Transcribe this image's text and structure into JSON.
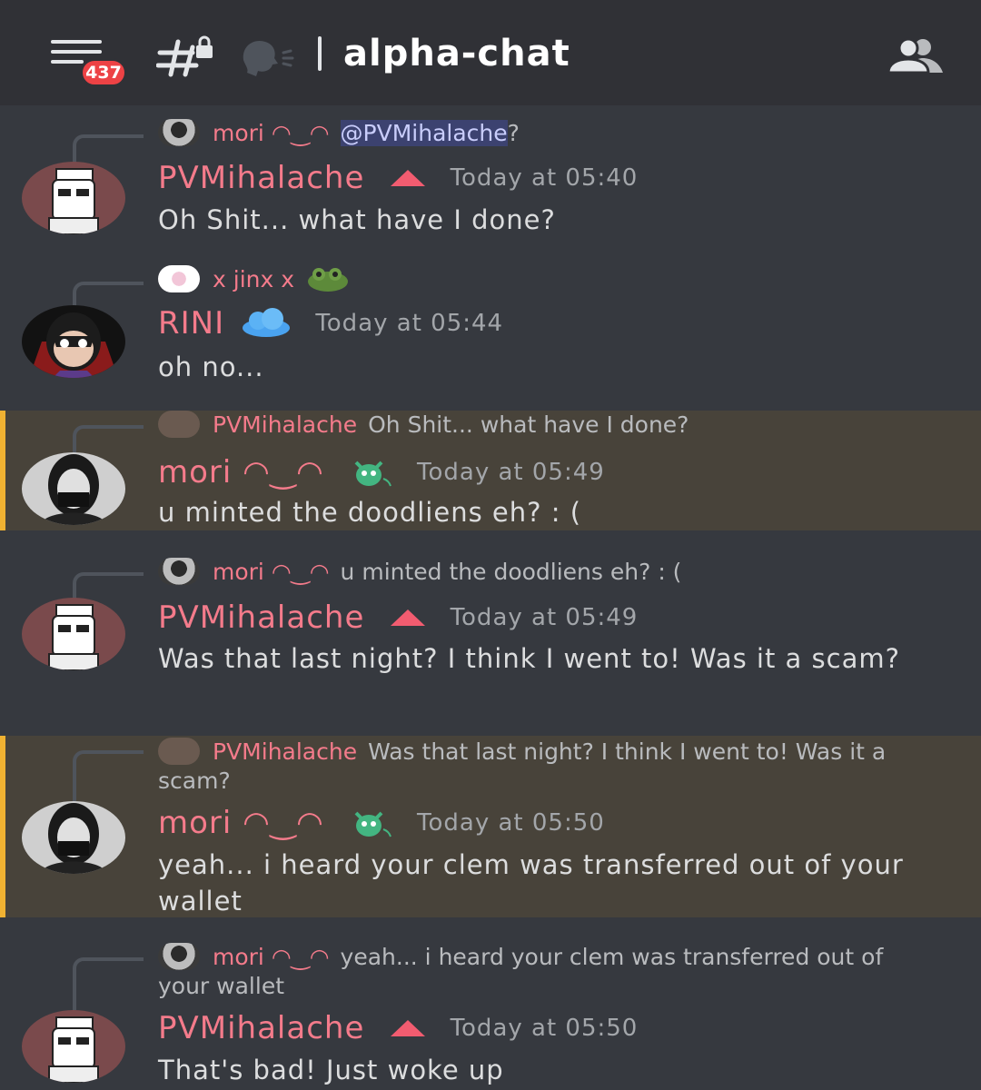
{
  "header": {
    "badge_count": "437",
    "channel_name": "alpha-chat"
  },
  "messages": [
    {
      "reply": {
        "author": "mori ◠‿◠",
        "mention": "@PVMihalache",
        "text": "?"
      },
      "author": "PVMihalache",
      "time": "Today at 05:40",
      "text": "Oh Shit... what have I done?"
    },
    {
      "reply": {
        "author": "x jinx x",
        "text": ""
      },
      "author": "RINI",
      "time": "Today at 05:44",
      "text": "oh no..."
    },
    {
      "reply": {
        "author": "PVMihalache",
        "text": "Oh Shit... what have I done?"
      },
      "author": "mori ◠‿◠",
      "time": "Today at 05:49",
      "text": "u minted the doodliens eh? : ("
    },
    {
      "reply": {
        "author": "mori ◠‿◠",
        "text": "u minted the doodliens eh? : ("
      },
      "author": "PVMihalache",
      "time": "Today at 05:49",
      "text": "Was that last night? I think I went to! Was it a scam?"
    },
    {
      "reply": {
        "author": "PVMihalache",
        "text": "Was that last night? I think I went to! Was it a scam?"
      },
      "author": "mori ◠‿◠",
      "time": "Today at 05:50",
      "text": "yeah... i heard your clem was transferred out of your wallet"
    },
    {
      "reply": {
        "author": "mori ◠‿◠",
        "text": "yeah... i heard your clem was transferred out of your wallet"
      },
      "author": "PVMihalache",
      "time": "Today at 05:50",
      "text": "That's  bad! Just woke up"
    }
  ]
}
